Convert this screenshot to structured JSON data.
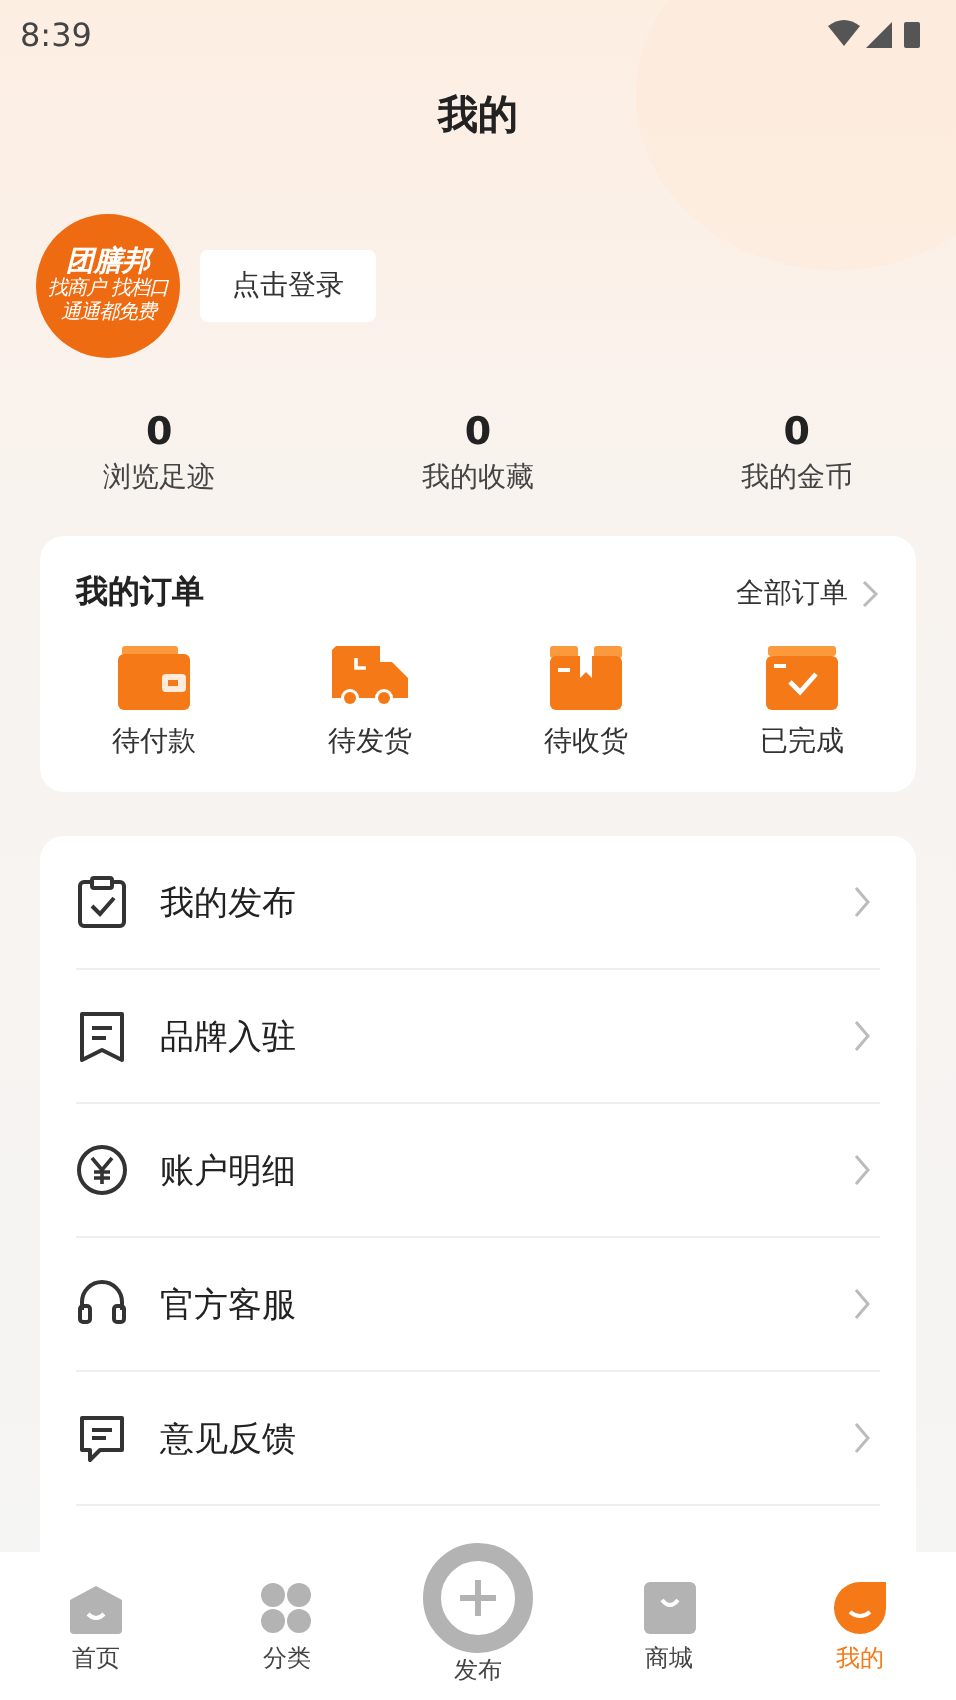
{
  "status_bar": {
    "time": "8:39"
  },
  "header": {
    "title": "我的"
  },
  "profile": {
    "logo": {
      "name": "团膳邦",
      "line_1": "找商户 找档口",
      "line_2": "通通都免费"
    },
    "login_button": "点击登录"
  },
  "stats": [
    {
      "value": "0",
      "label": "浏览足迹"
    },
    {
      "value": "0",
      "label": "我的收藏"
    },
    {
      "value": "0",
      "label": "我的金币"
    }
  ],
  "orders": {
    "title": "我的订单",
    "all_link": "全部订单",
    "items": [
      {
        "kind": "wallet",
        "label": "待付款"
      },
      {
        "kind": "truck",
        "label": "待发货"
      },
      {
        "kind": "box",
        "label": "待收货"
      },
      {
        "kind": "done",
        "label": "已完成"
      }
    ]
  },
  "menu": [
    {
      "kind": "clipboard",
      "label": "我的发布"
    },
    {
      "kind": "bookmark",
      "label": "品牌入驻"
    },
    {
      "kind": "yen",
      "label": "账户明细"
    },
    {
      "kind": "headset",
      "label": "官方客服"
    },
    {
      "kind": "chat",
      "label": "意见反馈"
    }
  ],
  "tab_bar": [
    {
      "kind": "home",
      "label": "首页",
      "selected": false
    },
    {
      "kind": "grid",
      "label": "分类",
      "selected": false
    },
    {
      "kind": "plus",
      "label": "发布",
      "selected": false
    },
    {
      "kind": "shop",
      "label": "商城",
      "selected": false
    },
    {
      "kind": "me",
      "label": "我的",
      "selected": true
    }
  ]
}
